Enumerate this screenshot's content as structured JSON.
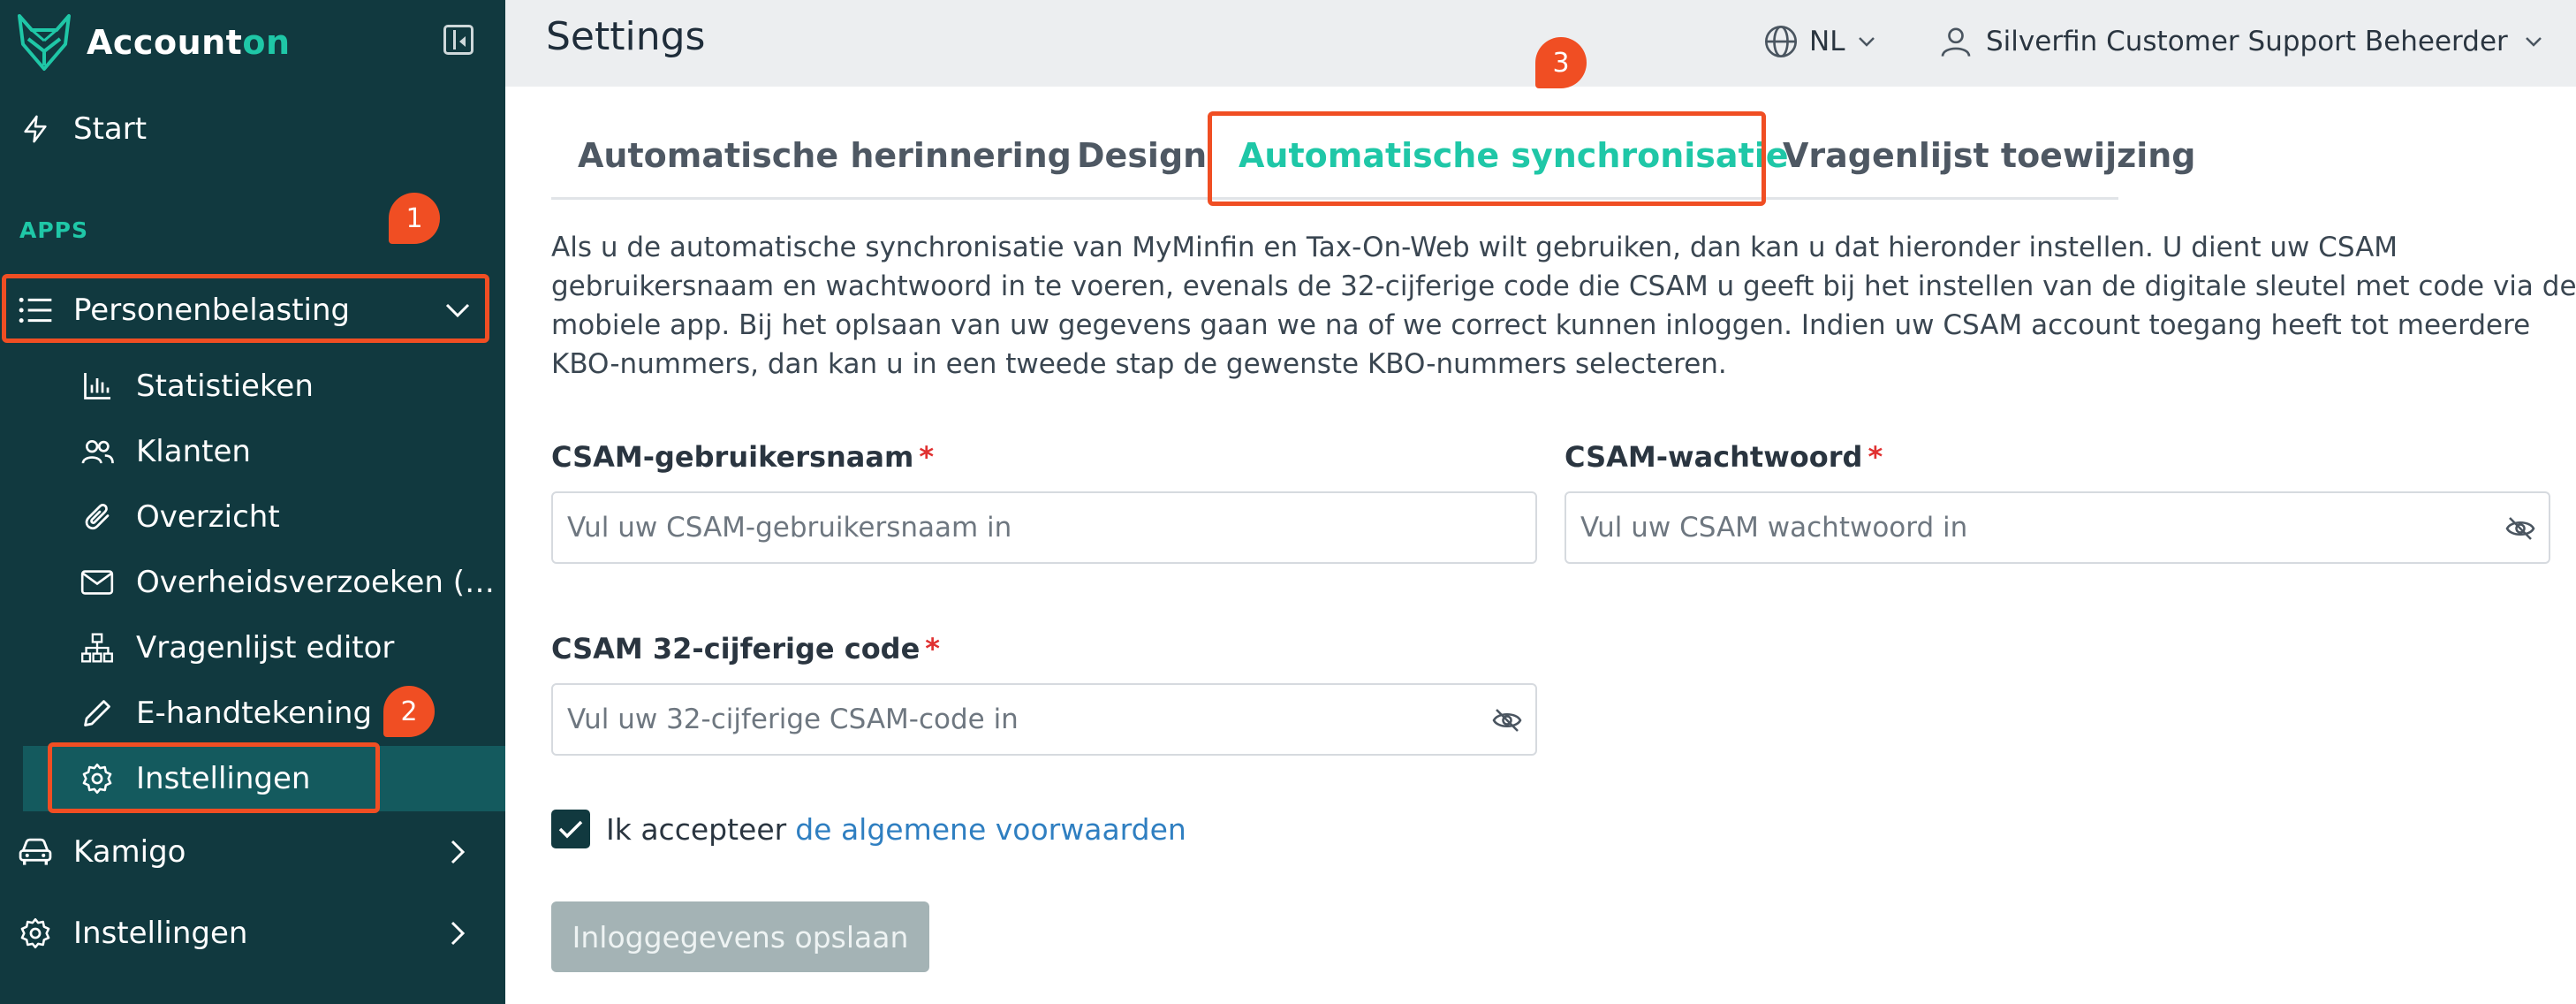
{
  "app": {
    "logo_part1": "Account",
    "logo_part2": "on",
    "accent_color": "#1fc7a7",
    "sidebar_bg": "#11393f",
    "highlight_color": "#f04e23"
  },
  "sidebar": {
    "start_label": "Start",
    "apps_label": "APPS",
    "personen_label": "Personenbelasting",
    "sub_items": [
      {
        "label": "Statistieken",
        "icon": "bar-chart-icon"
      },
      {
        "label": "Klanten",
        "icon": "users-icon"
      },
      {
        "label": "Overzicht",
        "icon": "paperclip-icon"
      },
      {
        "label": "Overheidsverzoeken (…",
        "icon": "mail-icon"
      },
      {
        "label": "Vragenlijst editor",
        "icon": "sitemap-icon"
      },
      {
        "label": "E-handtekening",
        "icon": "pen-icon"
      },
      {
        "label": "Instellingen",
        "icon": "gear-icon"
      }
    ],
    "kamigo_label": "Kamigo",
    "instellingen_label": "Instellingen"
  },
  "markers": {
    "m1": "1",
    "m2": "2",
    "m3": "3"
  },
  "header": {
    "title": "Settings",
    "language": "NL",
    "user": "Silverfin Customer Support Beheerder"
  },
  "tabs": [
    {
      "label": "Automatische herinnering"
    },
    {
      "label": "Design"
    },
    {
      "label": "Automatische synchronisatie",
      "active": true
    },
    {
      "label": "Vragenlijst toewijzing"
    }
  ],
  "form": {
    "description": "Als u de automatische synchronisatie van MyMinfin en Tax-On-Web wilt gebruiken, dan kan u dat hieronder instellen. U dient uw CSAM gebruikersnaam en wachtwoord in te voeren, evenals de 32-cijferige code die CSAM u geeft bij het instellen van de digitale sleutel met code via de mobiele app. Bij het oplsaan van uw gegevens gaan we na of we correct kunnen inloggen. Indien uw CSAM account toegang heeft tot meerdere KBO-nummers, dan kan u in een tweede stap de gewenste KBO-nummers selecteren.",
    "username_label": "CSAM-gebruikersnaam",
    "username_placeholder": "Vul uw CSAM-gebruikersnaam in",
    "password_label": "CSAM-wachtwoord",
    "password_placeholder": "Vul uw CSAM wachtwoord in",
    "code_label": "CSAM 32-cijferige code",
    "code_placeholder": "Vul uw 32-cijferige CSAM-code in",
    "required_mark": "*",
    "accept_text": "Ik accepteer",
    "accept_link": "de algemene voorwaarden",
    "accept_checked": true,
    "save_label": "Inloggegevens opslaan"
  }
}
